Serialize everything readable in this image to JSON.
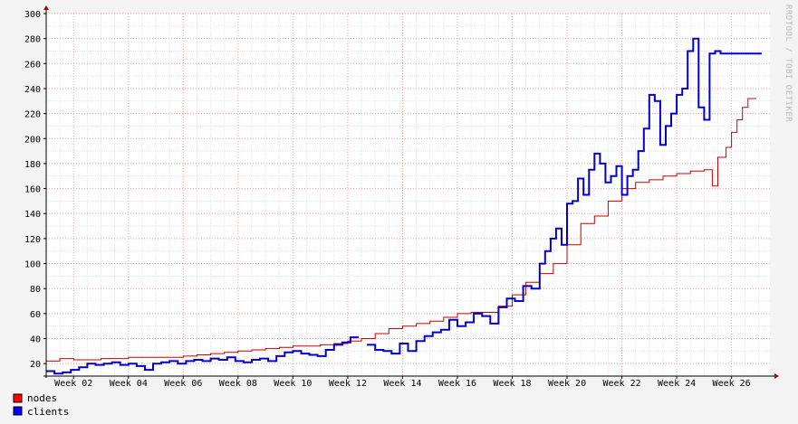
{
  "chart_data": {
    "type": "line",
    "watermark": "RRDTOOL / TOBI OETIKER",
    "ylim": [
      10,
      300
    ],
    "yticks": [
      20,
      40,
      60,
      80,
      100,
      120,
      140,
      160,
      180,
      200,
      220,
      240,
      260,
      280,
      300
    ],
    "xlim": [
      1,
      27.4
    ],
    "xticks": [
      {
        "label": "Week 02",
        "week": 2
      },
      {
        "label": "Week 04",
        "week": 4
      },
      {
        "label": "Week 06",
        "week": 6
      },
      {
        "label": "Week 08",
        "week": 8
      },
      {
        "label": "Week 10",
        "week": 10
      },
      {
        "label": "Week 12",
        "week": 12
      },
      {
        "label": "Week 14",
        "week": 14
      },
      {
        "label": "Week 16",
        "week": 16
      },
      {
        "label": "Week 18",
        "week": 18
      },
      {
        "label": "Week 20",
        "week": 20
      },
      {
        "label": "Week 22",
        "week": 22
      },
      {
        "label": "Week 24",
        "week": 24
      },
      {
        "label": "Week 26",
        "week": 26
      }
    ],
    "grid": true,
    "legend_position": "bottom-left",
    "series": [
      {
        "name": "nodes",
        "color": "#cc0000",
        "x": [
          1.0,
          1.5,
          2.0,
          2.5,
          3.0,
          3.5,
          4.0,
          4.5,
          5.0,
          5.5,
          6.0,
          6.5,
          7.0,
          7.5,
          8.0,
          8.5,
          9.0,
          9.5,
          10.0,
          10.5,
          11.0,
          11.5,
          12.0,
          12.5,
          13.0,
          13.5,
          14.0,
          14.5,
          15.0,
          15.5,
          16.0,
          16.5,
          17.0,
          17.5,
          18.0,
          18.5,
          19.0,
          19.5,
          20.0,
          20.5,
          21.0,
          21.5,
          22.0,
          22.5,
          23.0,
          23.5,
          24.0,
          24.5,
          25.0,
          25.3,
          25.5,
          25.8,
          26.0,
          26.2,
          26.4,
          26.6
        ],
        "values": [
          22,
          24,
          23,
          23,
          24,
          24,
          25,
          25,
          25,
          25,
          26,
          27,
          28,
          29,
          30,
          31,
          32,
          33,
          34,
          34,
          35,
          36,
          38,
          40,
          44,
          48,
          50,
          52,
          54,
          57,
          60,
          61,
          61,
          66,
          75,
          85,
          92,
          100,
          115,
          132,
          138,
          150,
          160,
          165,
          167,
          170,
          172,
          174,
          175,
          162,
          185,
          193,
          205,
          215,
          225,
          232
        ]
      },
      {
        "name": "clients",
        "color": "#0000cc",
        "x": [
          1.0,
          1.3,
          1.6,
          1.9,
          2.2,
          2.5,
          2.8,
          3.1,
          3.4,
          3.7,
          4.0,
          4.3,
          4.6,
          4.9,
          5.2,
          5.5,
          5.8,
          6.1,
          6.4,
          6.7,
          7.0,
          7.3,
          7.6,
          7.9,
          8.2,
          8.5,
          8.8,
          9.1,
          9.4,
          9.7,
          10.0,
          10.3,
          10.6,
          10.9,
          11.2,
          11.5,
          11.8,
          12.1,
          12.4,
          12.7,
          13.0,
          13.3,
          13.6,
          13.9,
          14.2,
          14.5,
          14.8,
          15.1,
          15.4,
          15.7,
          16.0,
          16.3,
          16.6,
          16.9,
          17.2,
          17.5,
          17.8,
          18.1,
          18.4,
          18.7,
          19.0,
          19.2,
          19.4,
          19.6,
          19.8,
          20.0,
          20.2,
          20.4,
          20.6,
          20.8,
          21.0,
          21.2,
          21.4,
          21.6,
          21.8,
          22.0,
          22.2,
          22.4,
          22.6,
          22.8,
          23.0,
          23.2,
          23.4,
          23.6,
          23.8,
          24.0,
          24.2,
          24.4,
          24.6,
          24.8,
          25.0,
          25.2,
          25.4,
          25.6,
          25.8,
          26.0,
          26.2,
          26.4,
          26.6,
          26.8
        ],
        "values": [
          14,
          12,
          13,
          15,
          17,
          20,
          19,
          20,
          21,
          19,
          20,
          18,
          15,
          20,
          21,
          22,
          20,
          22,
          23,
          22,
          24,
          23,
          25,
          22,
          21,
          23,
          24,
          22,
          26,
          29,
          30,
          28,
          27,
          26,
          31,
          35,
          37,
          41,
          null,
          35,
          31,
          30,
          28,
          36,
          30,
          38,
          42,
          45,
          47,
          55,
          50,
          53,
          60,
          58,
          52,
          65,
          72,
          70,
          82,
          80,
          100,
          110,
          120,
          128,
          115,
          148,
          150,
          168,
          155,
          175,
          188,
          180,
          165,
          170,
          178,
          155,
          170,
          175,
          190,
          208,
          235,
          230,
          195,
          210,
          220,
          235,
          240,
          270,
          280,
          225,
          215,
          268,
          270,
          268,
          268,
          268,
          268,
          268,
          268,
          268
        ]
      }
    ]
  }
}
